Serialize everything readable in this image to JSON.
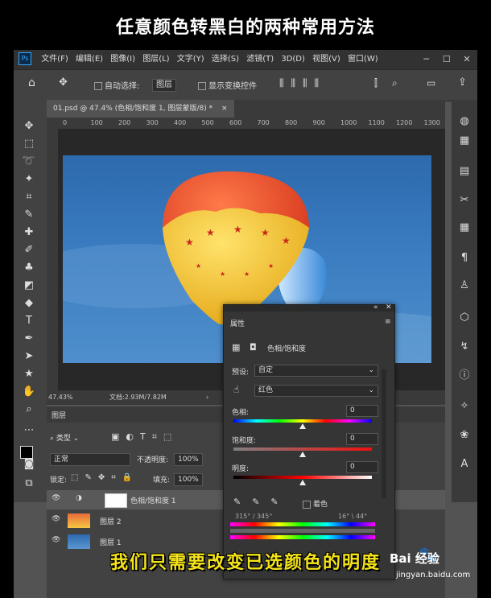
{
  "caption_top": "任意颜色转黑白的两种常用方法",
  "caption_bottom": "我们只需要改变已选颜色的明度",
  "app": {
    "logo": "Ps"
  },
  "menu": [
    "文件(F)",
    "编辑(E)",
    "图像(I)",
    "图层(L)",
    "文字(Y)",
    "选择(S)",
    "滤镜(T)",
    "3D(D)",
    "视图(V)",
    "窗口(W)"
  ],
  "window_controls": [
    "─",
    "☐",
    "✕"
  ],
  "options": {
    "auto_select_label": "自动选择:",
    "auto_select_value": "图层",
    "show_transform_label": "显示变换控件"
  },
  "document": {
    "tab_title": "01.psd @ 47.4% (色相/饱和度 1, 图层蒙版/8) *",
    "close": "×"
  },
  "ruler_ticks": [
    "0",
    "100",
    "200",
    "300",
    "400",
    "500",
    "600",
    "700",
    "800",
    "900",
    "1000",
    "1100",
    "1200",
    "1300"
  ],
  "status": {
    "zoom": "47.43%",
    "doc_info": "文档:2.93M/7.82M",
    "arrow": "›"
  },
  "layers": {
    "tab": "图层",
    "filter_label": "类型",
    "blend_mode": "正常",
    "opacity_label": "不透明度:",
    "opacity_value": "100%",
    "lock_label": "锁定:",
    "fill_label": "填充:",
    "fill_value": "100%",
    "items": [
      {
        "name": "色相/饱和度 1"
      },
      {
        "name": "图层 2"
      },
      {
        "name": "图层 1"
      }
    ]
  },
  "properties": {
    "title": "属性",
    "adjustment": "色相/饱和度",
    "preset_label": "预设:",
    "preset_value": "自定",
    "channel_value": "红色",
    "hue_label": "色相:",
    "hue_value": "0",
    "saturation_label": "饱和度:",
    "saturation_value": "0",
    "lightness_label": "明度:",
    "lightness_value": "0",
    "colorize_label": "着色",
    "range_left": "315° / 345°",
    "range_right": "16° \\ 44°",
    "collapse": "«",
    "close": "✕"
  },
  "watermark": {
    "brand": "Bai  经验",
    "url": "jingyan.baidu.com"
  },
  "colors": {
    "bg": "#535353",
    "panel": "#424242",
    "accent": "#31a8ff",
    "caption_yellow": "#f5e41a"
  }
}
